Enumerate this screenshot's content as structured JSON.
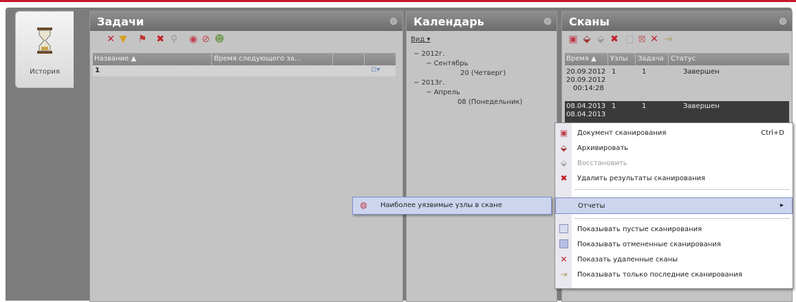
{
  "history": {
    "label": "История",
    "icon": "hourglass-icon"
  },
  "tasks": {
    "title": "Задачи",
    "toolbar_icons": [
      "delete-icon",
      "filter-icon",
      "flag-icon",
      "delete-icon",
      "search-icon",
      "check-icon",
      "cancel-icon",
      "person-icon"
    ],
    "columns": [
      "Название",
      "Время следующего за..."
    ],
    "rows": [
      {
        "name": "1"
      }
    ]
  },
  "calendar": {
    "title": "Календарь",
    "view_label": "Вид",
    "tree": [
      "2012г.",
      "Сентябрь",
      "20 (Четверг)",
      "2013г.",
      "Апрель",
      "08 (Понедельник)"
    ]
  },
  "scans": {
    "title": "Сканы",
    "columns": [
      "Время",
      "Узлы",
      "Задача",
      "Статус"
    ],
    "rows": [
      {
        "time": [
          "20.09.2012",
          "20.09.2012",
          "00:14:28"
        ],
        "nodes": "1",
        "task": "1",
        "status": "Завершен"
      },
      {
        "time": [
          "08.04.2013",
          "08.04.2013"
        ],
        "nodes": "1",
        "task": "1",
        "status": "Завершен"
      }
    ]
  },
  "context_menu": {
    "scan_document": "Документ сканирования",
    "scan_document_shortcut": "Ctrl+D",
    "archive": "Архивировать",
    "restore": "Восстановить",
    "delete_results": "Удалить результаты сканирования",
    "reports": "Отчеты",
    "show_empty": "Показывать пустые сканирования",
    "show_cancelled": "Показывать отмененные сканирования",
    "show_deleted": "Показать удаленные сканы",
    "show_latest": "Показывать только последние сканирования"
  },
  "submenu": {
    "vulnerable_nodes": "Наиболее уязвимые узлы в скане"
  },
  "colors": {
    "accent_red": "#c8192a",
    "highlight": "#cdd5ee",
    "header": "#7a7a7a"
  }
}
